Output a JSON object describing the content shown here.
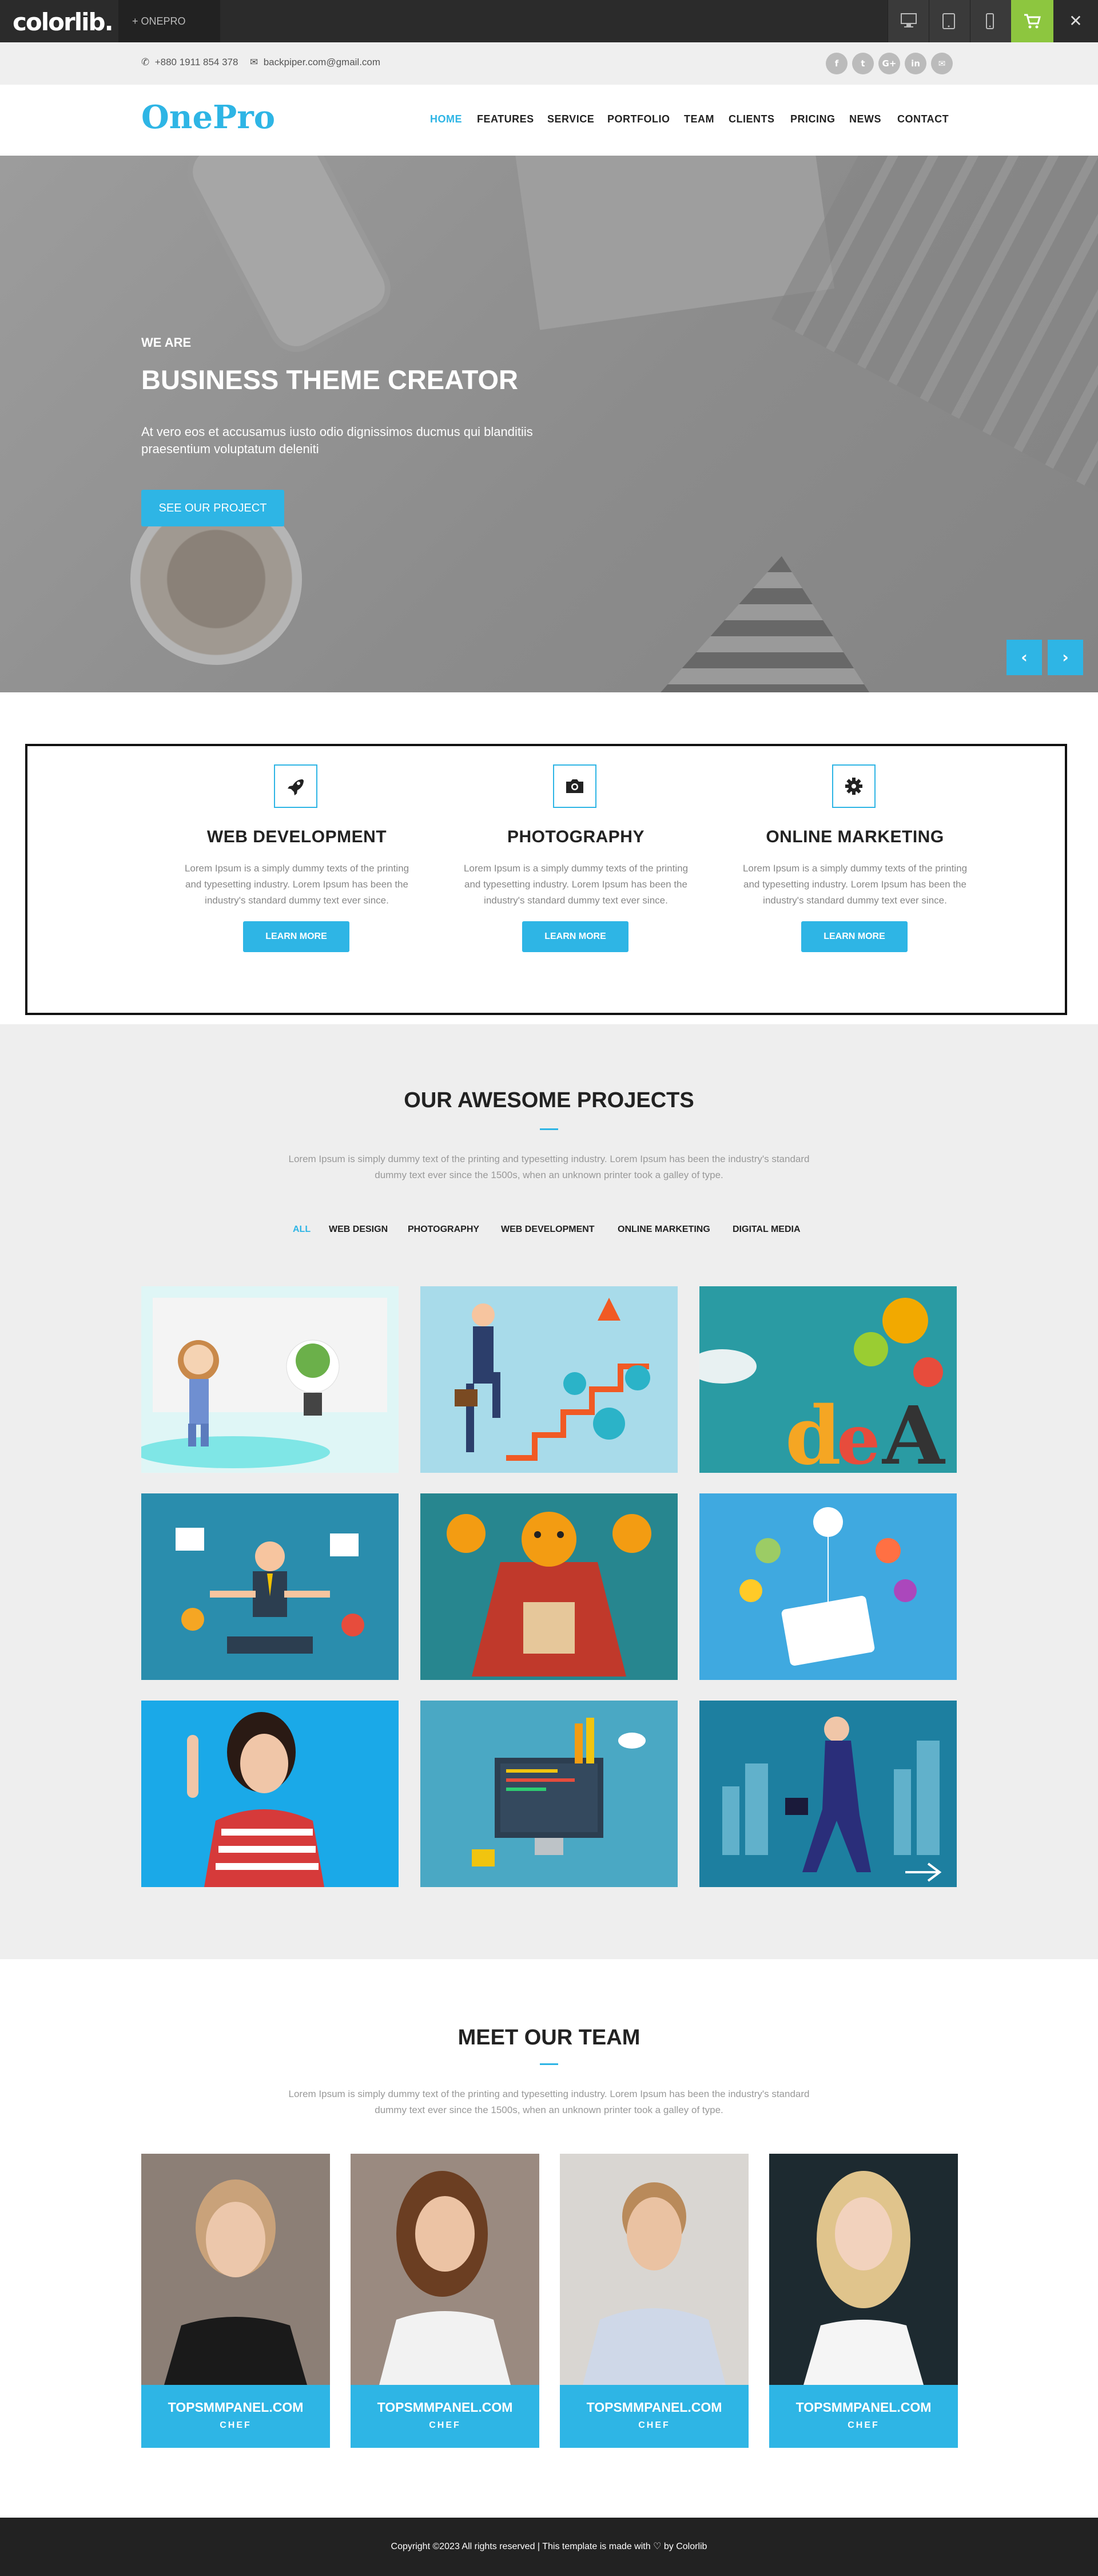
{
  "colorlib_bar": {
    "logo": "colorlib.",
    "tab_label": "+  ONEPRO",
    "close": "✕"
  },
  "info_bar": {
    "phone": "+880 1911 854 378",
    "email": "backpiper.com@gmail.com",
    "socials": [
      "f",
      "t",
      "G+",
      "in",
      "✉"
    ]
  },
  "nav": {
    "brand": "OnePro",
    "items": [
      "HOME",
      "FEATURES",
      "SERVICE",
      "PORTFOLIO",
      "TEAM",
      "CLIENTS",
      "PRICING",
      "NEWS",
      "CONTACT"
    ],
    "active_index": 0
  },
  "hero": {
    "kicker": "WE ARE",
    "title": "BUSINESS THEME CREATOR",
    "text": "At vero eos et accusamus iusto odio dignissimos ducmus qui blanditiis praesentium voluptatum deleniti",
    "button": "SEE OUR PROJECT",
    "prev": "‹",
    "next": "›"
  },
  "services": [
    {
      "icon": "rocket-icon",
      "title": "WEB DEVELOPMENT",
      "text": "Lorem Ipsum is a simply dummy texts of the printing and typesetting industry. Lorem Ipsum has been the industry's standard dummy text ever since.",
      "button": "LEARN MORE"
    },
    {
      "icon": "camera-icon",
      "title": "PHOTOGRAPHY",
      "text": "Lorem Ipsum is a simply dummy texts of the printing and typesetting industry. Lorem Ipsum has been the industry's standard dummy text ever since.",
      "button": "LEARN MORE"
    },
    {
      "icon": "gear-icon",
      "title": "ONLINE MARKETING",
      "text": "Lorem Ipsum is a simply dummy texts of the printing and typesetting industry. Lorem Ipsum has been the industry's standard dummy text ever since.",
      "button": "LEARN MORE"
    }
  ],
  "projects": {
    "title": "OUR AWESOME PROJECTS",
    "text": "Lorem Ipsum is simply dummy text of the printing and typesetting industry. Lorem Ipsum has been the industry's standard dummy text ever since the 1500s, when an unknown printer took a galley of type.",
    "filters": [
      "ALL",
      "WEB DESIGN",
      "PHOTOGRAPHY",
      "WEB DEVELOPMENT",
      "ONLINE MARKETING",
      "DIGITAL MEDIA"
    ],
    "active_filter": 0
  },
  "team": {
    "title": "MEET OUR TEAM",
    "text": "Lorem Ipsum is simply dummy text of the printing and typesetting industry. Lorem Ipsum has been the industry's standard dummy text ever since the 1500s, when an unknown printer took a galley of type.",
    "members": [
      {
        "name": "TOPSMMPANEL.COM",
        "role": "CHEF"
      },
      {
        "name": "TOPSMMPANEL.COM",
        "role": "CHEF"
      },
      {
        "name": "TOPSMMPANEL.COM",
        "role": "CHEF"
      },
      {
        "name": "TOPSMMPANEL.COM",
        "role": "CHEF"
      }
    ]
  },
  "footer": {
    "text": "Copyright ©2023 All rights reserved | This template is made with ♡ by Colorlib"
  },
  "colors": {
    "accent": "#2eb5e5",
    "cart": "#8dc63f",
    "dark": "#222222"
  }
}
